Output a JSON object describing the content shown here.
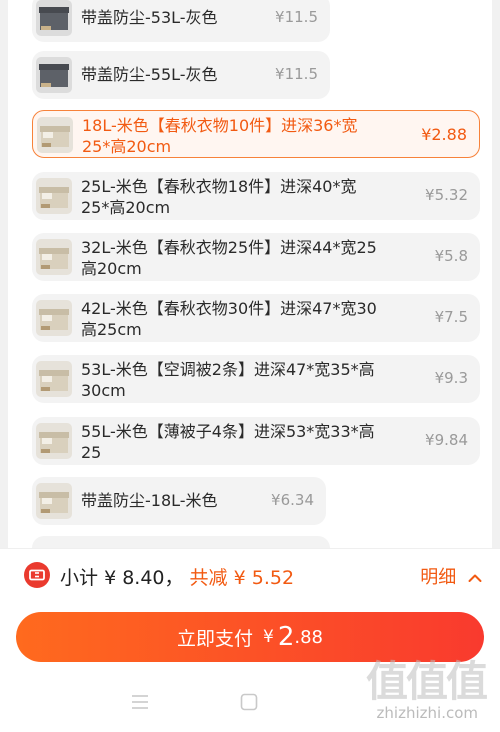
{
  "sku_options": [
    {
      "label": "带盖防尘-53L-灰色",
      "price": "¥11.5",
      "thumb": "gray-box",
      "selected": false
    },
    {
      "label": "带盖防尘-55L-灰色",
      "price": "¥11.5",
      "thumb": "gray-box",
      "selected": false
    },
    {
      "label": "18L-米色【春秋衣物10件】进深36*宽25*高20cm",
      "price": "¥2.88",
      "thumb": "beige-box",
      "selected": true
    },
    {
      "label": "25L-米色【春秋衣物18件】进深40*宽25*高20cm",
      "price": "¥5.32",
      "thumb": "beige-box",
      "selected": false
    },
    {
      "label": "32L-米色【春秋衣物25件】进深44*宽25高20cm",
      "price": "¥5.8",
      "thumb": "beige-box",
      "selected": false
    },
    {
      "label": "42L-米色【春秋衣物30件】进深47*宽30高25cm",
      "price": "¥7.5",
      "thumb": "beige-box",
      "selected": false
    },
    {
      "label": "53L-米色【空调被2条】进深47*宽35*高30cm",
      "price": "¥9.3",
      "thumb": "beige-box",
      "selected": false
    },
    {
      "label": "55L-米色【薄被子4条】进深53*宽33*高25",
      "price": "¥9.84",
      "thumb": "beige-box",
      "selected": false
    },
    {
      "label": "带盖防尘-18L-米色",
      "price": "¥6.34",
      "thumb": "beige-box",
      "selected": false
    }
  ],
  "summary": {
    "subtotal_prefix": "小计",
    "subtotal_value": "¥ 8.40，",
    "discount_prefix": "共减",
    "discount_value": "¥ 5.52",
    "detail_label": "明细"
  },
  "pay_button": {
    "label": "立即支付",
    "currency": "¥",
    "amount_int": "2",
    "amount_dec": ".88"
  },
  "watermark": {
    "logo": "值值值",
    "url": "zhizhizhi.com"
  },
  "colors": {
    "accent": "#f25a12",
    "selected_border": "#f7823a",
    "coupon_red": "#ea3a2e",
    "pay_gradient_start": "#ff6a1e",
    "pay_gradient_end": "#f93a2e"
  },
  "icons": {
    "coupon": "coupon-ticket-icon",
    "detail": "chevron-up-icon",
    "nav_menu": "menu-icon",
    "nav_home": "home-square-icon"
  }
}
